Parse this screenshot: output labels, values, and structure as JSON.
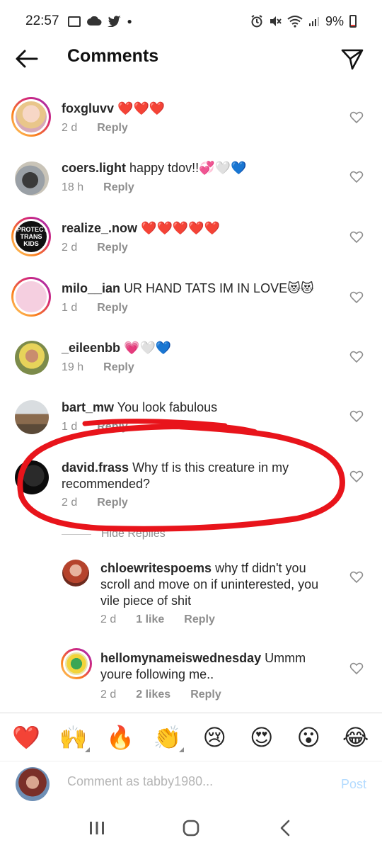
{
  "status_bar": {
    "time": "22:57",
    "battery": "9%"
  },
  "header": {
    "title": "Comments"
  },
  "comments": [
    {
      "user": "foxgluvv",
      "text": "❤️❤️❤️",
      "time": "2 d",
      "reply": "Reply"
    },
    {
      "user": "coers.light",
      "text": "happy tdov!!💞🤍💙",
      "time": "18 h",
      "reply": "Reply"
    },
    {
      "user": "realize_.now",
      "text": "❤️❤️❤️❤️❤️",
      "time": "2 d",
      "reply": "Reply",
      "avatar_text": "PROTECT TRANS KIDS"
    },
    {
      "user": "milo__ian",
      "text": "UR HAND TATS IM IN LOVE😻😻",
      "time": "1 d",
      "reply": "Reply"
    },
    {
      "user": "_eileenbb",
      "text": "💗🤍💙",
      "time": "19 h",
      "reply": "Reply"
    },
    {
      "user": "bart_mw",
      "text": "You look fabulous",
      "time": "1 d",
      "reply": "Reply"
    },
    {
      "user": "david.frass",
      "text": "Why tf is this creature in my recommended?",
      "time": "2 d",
      "reply": "Reply"
    }
  ],
  "hide_replies": "Hide Replies",
  "replies": [
    {
      "user": "chloewritespoems",
      "text": "why tf didn't you scroll and move on if uninterested, you vile piece of shit",
      "time": "2 d",
      "likes": "1 like",
      "reply": "Reply"
    },
    {
      "user": "hellomynameiswednesday",
      "text": "Ummm youre following me..",
      "time": "2 d",
      "likes": "2 likes",
      "reply": "Reply"
    }
  ],
  "emojis": [
    "❤️",
    "🙌",
    "🔥",
    "👏",
    "😢",
    "😍",
    "😮",
    "😂"
  ],
  "input": {
    "placeholder": "Comment as tabby1980...",
    "post_label": "Post"
  },
  "colors": {
    "annotation_red": "#e8141b",
    "link_blue": "#b3dbff",
    "meta_gray": "#8e8e8e"
  }
}
